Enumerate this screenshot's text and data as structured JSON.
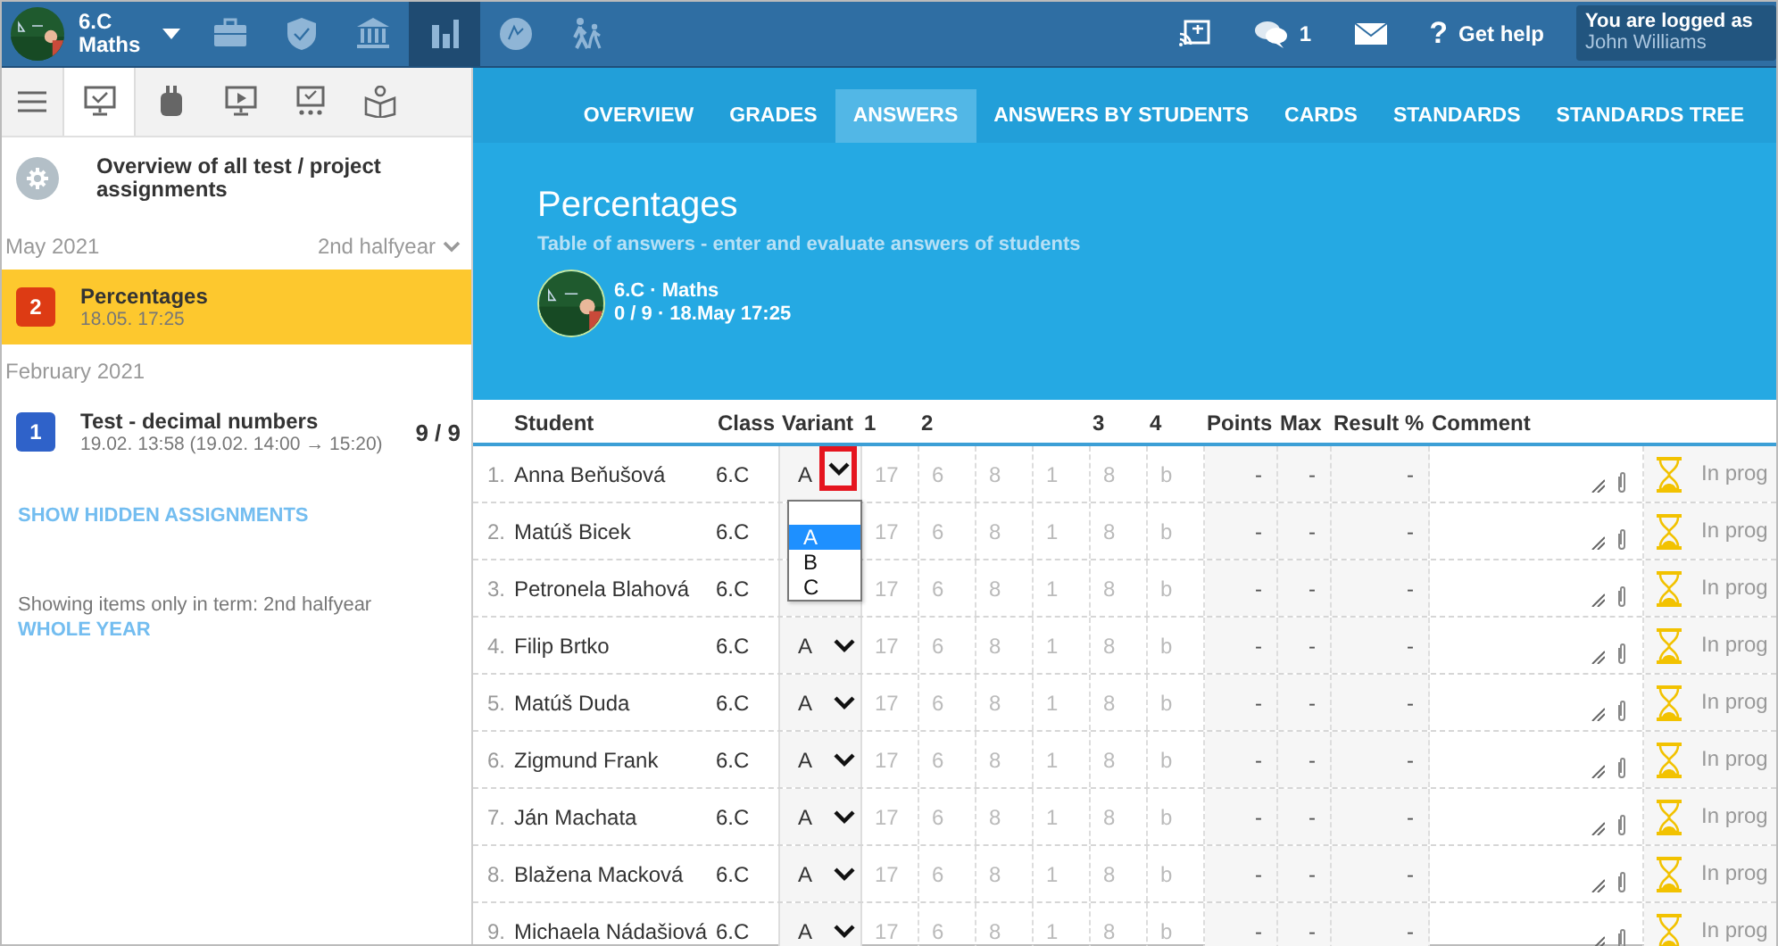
{
  "topbar": {
    "class_name": "6.C",
    "subject": "Maths",
    "nav": [
      {
        "selected": false
      },
      {
        "selected": false
      },
      {
        "selected": false
      },
      {
        "selected": true
      },
      {
        "selected": false
      },
      {
        "selected": false
      }
    ],
    "messages_count": "1",
    "help": {
      "icon": "?",
      "label": "Get help"
    },
    "user": {
      "label": "You are logged as",
      "name": "John Williams"
    }
  },
  "sidebar": {
    "tabs": [
      {
        "selected": true
      },
      {
        "selected": false
      },
      {
        "selected": false
      },
      {
        "selected": false
      },
      {
        "selected": false
      }
    ],
    "overview": "Overview of all test / project assignments",
    "groups": [
      {
        "month": "May 2021",
        "term": "2nd halfyear",
        "items": [
          {
            "number": "2",
            "color": "#dd3b14",
            "title": "Percentages",
            "date": "18.05. 17:25",
            "selected": true
          }
        ]
      },
      {
        "month": "February 2021",
        "items": [
          {
            "number": "1",
            "color": "#2f62c9",
            "title": "Test - decimal numbers",
            "date": "19.02. 13:58 (19.02. 14:00 → 15:20)",
            "count": "9 / 9",
            "selected": false
          }
        ]
      }
    ],
    "show_hidden": "SHOW HIDDEN ASSIGNMENTS",
    "term_note": "Showing items only in term: 2nd halfyear",
    "whole_year": "WHOLE YEAR"
  },
  "tabs": [
    {
      "label": "OVERVIEW",
      "selected": false
    },
    {
      "label": "GRADES",
      "selected": false
    },
    {
      "label": "ANSWERS",
      "selected": true
    },
    {
      "label": "ANSWERS BY STUDENTS",
      "selected": false
    },
    {
      "label": "CARDS",
      "selected": false
    },
    {
      "label": "STANDARDS",
      "selected": false
    },
    {
      "label": "STANDARDS TREE",
      "selected": false
    }
  ],
  "header": {
    "title": "Percentages",
    "subtitle": "Table of answers - enter and evaluate answers of students",
    "class_line": "6.C · Maths",
    "info_line": "0 / 9 · 18.May 17:25"
  },
  "table": {
    "columns": [
      "Student",
      "Class",
      "Variant",
      "1",
      "2",
      "3",
      "4",
      "Points",
      "Max",
      "Result %",
      "Comment"
    ],
    "rows": [
      {
        "number": "1.",
        "student": "Anna Beňušová",
        "class": "6.C",
        "variant": "A",
        "highlighted": true,
        "open": true,
        "options": [
          {
            "label": "A",
            "selected": true
          },
          {
            "label": "B",
            "selected": false
          },
          {
            "label": "C",
            "selected": false
          }
        ],
        "answers": [
          "17",
          "6",
          "8",
          "1",
          "8",
          "b"
        ],
        "points": "-",
        "max": "-",
        "result": "-",
        "status": "In prog"
      },
      {
        "number": "2.",
        "student": "Matúš Bicek",
        "class": "6.C",
        "answers": [
          "17",
          "6",
          "8",
          "1",
          "8",
          "b"
        ],
        "points": "-",
        "max": "-",
        "result": "-",
        "status": "In prog"
      },
      {
        "number": "3.",
        "student": "Petronela Blahová",
        "class": "6.C",
        "answers": [
          "17",
          "6",
          "8",
          "1",
          "8",
          "b"
        ],
        "points": "-",
        "max": "-",
        "result": "-",
        "status": "In prog"
      },
      {
        "number": "4.",
        "student": "Filip Brtko",
        "class": "6.C",
        "variant": "A",
        "answers": [
          "17",
          "6",
          "8",
          "1",
          "8",
          "b"
        ],
        "points": "-",
        "max": "-",
        "result": "-",
        "status": "In prog"
      },
      {
        "number": "5.",
        "student": "Matúš Duda",
        "class": "6.C",
        "variant": "A",
        "answers": [
          "17",
          "6",
          "8",
          "1",
          "8",
          "b"
        ],
        "points": "-",
        "max": "-",
        "result": "-",
        "status": "In prog"
      },
      {
        "number": "6.",
        "student": "Zigmund Frank",
        "class": "6.C",
        "variant": "A",
        "answers": [
          "17",
          "6",
          "8",
          "1",
          "8",
          "b"
        ],
        "points": "-",
        "max": "-",
        "result": "-",
        "status": "In prog"
      },
      {
        "number": "7.",
        "student": "Ján Machata",
        "class": "6.C",
        "variant": "A",
        "answers": [
          "17",
          "6",
          "8",
          "1",
          "8",
          "b"
        ],
        "points": "-",
        "max": "-",
        "result": "-",
        "status": "In prog"
      },
      {
        "number": "8.",
        "student": "Blažena Macková",
        "class": "6.C",
        "variant": "A",
        "answers": [
          "17",
          "6",
          "8",
          "1",
          "8",
          "b"
        ],
        "points": "-",
        "max": "-",
        "result": "-",
        "status": "In prog"
      },
      {
        "number": "9.",
        "student": "Michaela Nádašiová",
        "class": "6.C",
        "variant": "A",
        "answers": [
          "17",
          "6",
          "8",
          "1",
          "8",
          "b"
        ],
        "points": "-",
        "max": "-",
        "result": "-",
        "status": "In prog"
      }
    ]
  }
}
